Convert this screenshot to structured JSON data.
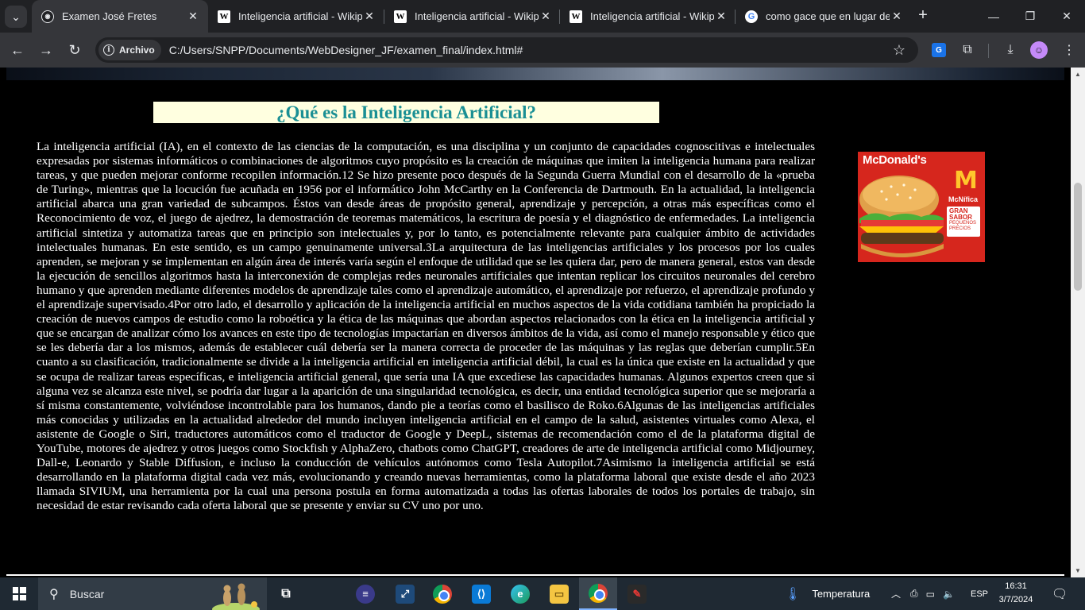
{
  "browser": {
    "tabs": [
      {
        "title": "Examen José Fretes",
        "favicon": "doc",
        "active": true
      },
      {
        "title": "Inteligencia artificial - Wikipe",
        "favicon": "wiki",
        "active": false
      },
      {
        "title": "Inteligencia artificial - Wikipe",
        "favicon": "wiki",
        "active": false
      },
      {
        "title": "Inteligencia artificial - Wikipe",
        "favicon": "wiki",
        "active": false
      },
      {
        "title": "como gace que en lugar de",
        "favicon": "google",
        "active": false
      }
    ],
    "site_chip_label": "Archivo",
    "url": "C:/Users/SNPP/Documents/WebDesigner_JF/examen_final/index.html#"
  },
  "page": {
    "heading": "¿Qué es la Inteligencia Artificial?",
    "body": "La inteligencia artificial (IA), en el contexto de las ciencias de la computación, es una disciplina y un conjunto de capacidades cognoscitivas e intelectuales expresadas por sistemas informáticos o combinaciones de algoritmos cuyo propósito es la creación de máquinas que imiten la inteligencia humana para realizar tareas, y que pueden mejorar conforme recopilen información.12 Se hizo presente poco después de la Segunda Guerra Mundial con el desarrollo de la «prueba de Turing», mientras que la locución fue acuñada en 1956 por el informático John McCarthy en la Conferencia de Dartmouth. En la actualidad, la inteligencia artificial abarca una gran variedad de subcampos. Éstos van desde áreas de propósito general, aprendizaje y percepción, a otras más específicas como el Reconocimiento de voz, el juego de ajedrez, la demostración de teoremas matemáticos, la escritura de poesía y el diagnóstico de enfermedades. La inteligencia artificial sintetiza y automatiza tareas que en principio son intelectuales y, por lo tanto, es potencialmente relevante para cualquier ámbito de actividades intelectuales humanas. En este sentido, es un campo genuinamente universal.3La arquitectura de las inteligencias artificiales y los procesos por los cuales aprenden, se mejoran y se implementan en algún área de interés varía según el enfoque de utilidad que se les quiera dar, pero de manera general, estos van desde la ejecución de sencillos algoritmos hasta la interconexión de complejas redes neuronales artificiales que intentan replicar los circuitos neuronales del cerebro humano y que aprenden mediante diferentes modelos de aprendizaje tales como el aprendizaje automático, el aprendizaje por refuerzo, el aprendizaje profundo y el aprendizaje supervisado.4Por otro lado, el desarrollo y aplicación de la inteligencia artificial en muchos aspectos de la vida cotidiana también ha propiciado la creación de nuevos campos de estudio como la roboética y la ética de las máquinas que abordan aspectos relacionados con la ética en la inteligencia artificial y que se encargan de analizar cómo los avances en este tipo de tecnologías impactarían en diversos ámbitos de la vida, así como el manejo responsable y ético que se les debería dar a los mismos, además de establecer cuál debería ser la manera correcta de proceder de las máquinas y las reglas que deberían cumplir.5En cuanto a su clasificación, tradicionalmente se divide a la inteligencia artificial en inteligencia artificial débil, la cual es la única que existe en la actualidad y que se ocupa de realizar tareas específicas, e inteligencia artificial general, que sería una IA que excediese las capacidades humanas. Algunos expertos creen que si alguna vez se alcanza este nivel, se podría dar lugar a la aparición de una singularidad tecnológica, es decir, una entidad tecnológica superior que se mejoraría a sí misma constantemente, volviéndose incontrolable para los humanos, dando pie a teorías como el basilisco de Roko.6Algunas de las inteligencias artificiales más conocidas y utilizadas en la actualidad alrededor del mundo incluyen inteligencia artificial en el campo de la salud, asistentes virtuales como Alexa, el asistente de Google o Siri, traductores automáticos como el traductor de Google y DeepL, sistemas de recomendación como el de la plataforma digital de YouTube, motores de ajedrez y otros juegos como Stockfish y AlphaZero, chatbots como ChatGPT, creadores de arte de inteligencia artificial como Midjourney, Dall-e, Leonardo y Stable Diffusion, e incluso la conducción de vehículos autónomos como Tesla Autopilot.7Asimismo la inteligencia artificial se está desarrollando en la plataforma digital cada vez más, evolucionando y creando nuevas herramientas, como la plataforma laboral que existe desde el año 2023 llamada SIVIUM, una herramienta por la cual una persona postula en forma automatizada a todas las ofertas laborales de todos los portales de trabajo, sin necesidad de estar revisando cada oferta laboral que se presente y enviar su CV uno por uno.",
    "ad": {
      "brand": "McDonald's",
      "logo": "M",
      "product": "McNífica",
      "badge_line1": "GRAN SABOR",
      "badge_line2": "PEQUEÑOS PRECIOS",
      "brand_color": "#d6261d",
      "logo_color": "#ffc72c"
    }
  },
  "taskbar": {
    "search_placeholder": "Buscar",
    "weather_label": "Temperatura",
    "language": "ESP",
    "time": "16:31",
    "date": "3/7/2024"
  },
  "icons": {
    "tab_search": "chevron-down-icon",
    "back": "arrow-left-icon",
    "forward": "arrow-right-icon",
    "reload": "reload-icon",
    "bookmark": "star-icon"
  }
}
